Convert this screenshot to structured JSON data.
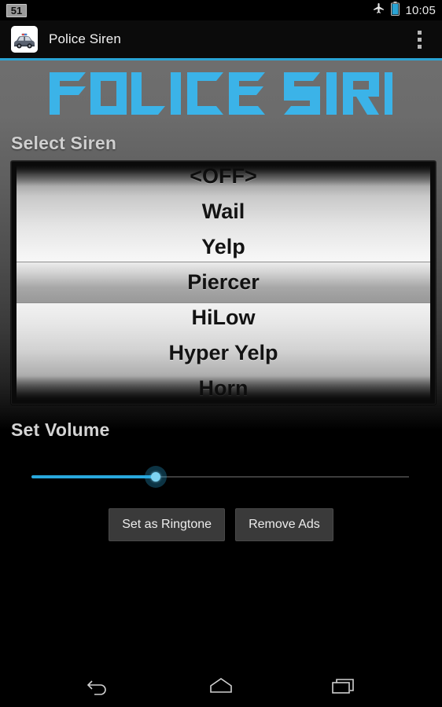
{
  "status_bar": {
    "notification_badge": "51",
    "airplane_icon": "airplane-mode-icon",
    "battery_icon": "battery-icon",
    "clock": "10:05"
  },
  "action_bar": {
    "app_icon": "police-car-icon",
    "title": "Police Siren",
    "overflow_icon": "overflow-menu-icon",
    "accent_color": "#2aa3d4"
  },
  "logo": {
    "text": "POLICE SIREN",
    "word1": "POLICE",
    "word2": "SIREN",
    "color": "#3bb3e8"
  },
  "select_siren": {
    "label": "Select Siren",
    "selected": "Piercer",
    "options": [
      "<OFF>",
      "Wail",
      "Yelp",
      "Piercer",
      "HiLow",
      "Hyper Yelp",
      "Horn"
    ]
  },
  "volume": {
    "label": "Set Volume",
    "value_percent": 33,
    "track_color": "#3d3d3d",
    "fill_color": "#29a8dd",
    "thumb_color": "#7fd4f2"
  },
  "buttons": {
    "set_as_ringtone": "Set as Ringtone",
    "remove_ads": "Remove Ads"
  },
  "nav_bar": {
    "back": "back-icon",
    "home": "home-icon",
    "recents": "recents-icon"
  }
}
